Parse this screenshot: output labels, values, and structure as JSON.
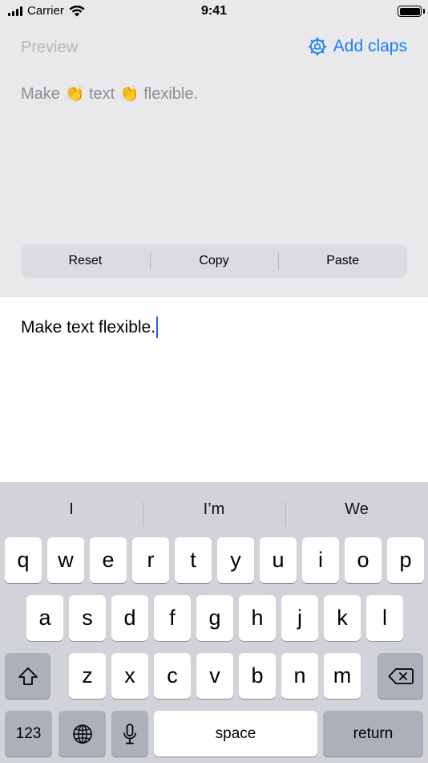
{
  "status_bar": {
    "carrier": "Carrier",
    "time": "9:41"
  },
  "header": {
    "preview_label": "Preview",
    "add_claps_label": "Add claps"
  },
  "preview": {
    "parts": [
      "Make",
      "👏",
      "text",
      "👏",
      "flexible."
    ]
  },
  "actions": {
    "reset_label": "Reset",
    "copy_label": "Copy",
    "paste_label": "Paste"
  },
  "editor": {
    "text": "Make text flexible."
  },
  "keyboard": {
    "suggestions": [
      "I",
      "I’m",
      "We"
    ],
    "row1": [
      "q",
      "w",
      "e",
      "r",
      "t",
      "y",
      "u",
      "i",
      "o",
      "p"
    ],
    "row2": [
      "a",
      "s",
      "d",
      "f",
      "g",
      "h",
      "j",
      "k",
      "l"
    ],
    "row3": [
      "z",
      "x",
      "c",
      "v",
      "b",
      "n",
      "m"
    ],
    "numbers_label": "123",
    "space_label": "space",
    "return_label": "return"
  },
  "colors": {
    "accent": "#1a7ef0",
    "cursor": "#2563d8",
    "panel_bg": "#e9e9ec",
    "keyboard_bg": "#d1d3d9"
  }
}
